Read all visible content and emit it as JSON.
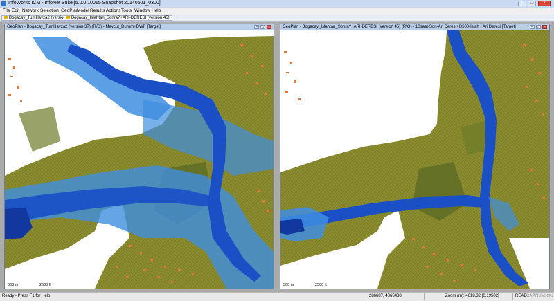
{
  "window": {
    "title": "InfoWorks ICM - InfoNet Suite [5.0.0.10015 Snapshot 20140601_0300]",
    "minimize_icon": "minimize-icon",
    "maximize_icon": "maximize-icon",
    "close_icon": "close-icon"
  },
  "menu": [
    "File",
    "Edit",
    "Network",
    "Selection",
    "GeoPlan",
    "Model",
    "Results",
    "Actions",
    "Tools",
    "Window",
    "Help"
  ],
  "tabs": [
    {
      "label": "Bogacay_TumHavza2 (version 37)"
    },
    {
      "label": "Bogacay_Islahtan_Sonra?+ARI-DERESI (version 45)"
    }
  ],
  "panes": [
    {
      "title": "GeoPlan - Bogacay_TumHavza2 (version 37) (R/O) - Mevcut_Durum+DWF [Target]",
      "scale_m": "500 m",
      "scale_ft": "2500 ft"
    },
    {
      "title": "GeoPlan - Bogacay_Islahtan_Sonra?+ARI-DERESI (version 45) (R/O) - 10saat-Son-Ari Deresi+Q500-Islah - Ari Deresi [Target]",
      "scale_m": "500 m",
      "scale_ft": "2500 ft"
    }
  ],
  "status": {
    "ready": "Ready - Press F1 for Help",
    "coords": "286687, 4065438",
    "zoom": "Zoom (m): 4618.32 [0.19502]",
    "read": "READ",
    "cap": "CAP",
    "num": "NUM",
    "scrl": "SCRL"
  },
  "colors": {
    "terrain": "#8a8a2e",
    "terrain_dark": "#5a6a24",
    "flood_light": "#3f8ee0",
    "flood_deep": "#1a4fc6",
    "buildings": "#e8753a",
    "background": "#ffffff"
  }
}
